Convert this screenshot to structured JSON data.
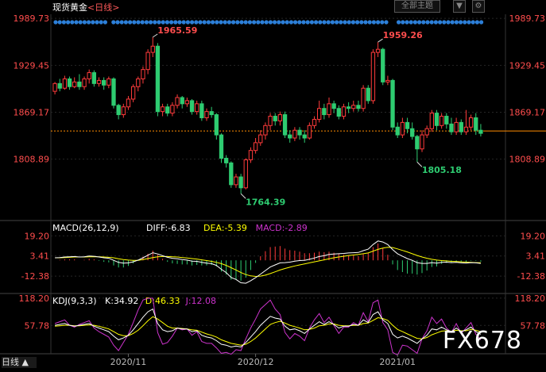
{
  "header": {
    "instrument": "现货黄金",
    "period": "<日线>",
    "sector_button": "全部主题",
    "dropdown_glyph": "▼",
    "settings_glyph": "⚙"
  },
  "watermark": "FX678",
  "period_tab": "日线 ▲",
  "colors": {
    "up": "#ff3b3b",
    "down": "#2ecc71",
    "macd": "#ffffff",
    "dea": "#ffff00",
    "k": "#ffffff",
    "d": "#ffff00",
    "j": "#cc33cc",
    "axis_text": "#ff4d4d",
    "grid": "#262626",
    "ref_line": "#ff8c00"
  },
  "chart_data": [
    {
      "type": "candlestick",
      "title": "现货黄金",
      "ylim": [
        1730,
        1995
      ],
      "y_ticks": [
        1989.73,
        1929.45,
        1869.17,
        1808.89
      ],
      "x_ticks": [
        "2020/11",
        "2020/12",
        "2021/01"
      ],
      "current_price_line": 1845.0,
      "annotations": [
        {
          "label": "1965.59",
          "index": 20
        },
        {
          "label": "1764.39",
          "index": 38
        },
        {
          "label": "1959.26",
          "index": 66
        },
        {
          "label": "1805.18",
          "index": 74
        }
      ],
      "candles": [
        [
          1896,
          1906,
          1892,
          1908
        ],
        [
          1906,
          1900,
          1896,
          1912
        ],
        [
          1900,
          1912,
          1898,
          1916
        ],
        [
          1912,
          1902,
          1898,
          1915
        ],
        [
          1902,
          1908,
          1900,
          1914
        ],
        [
          1908,
          1902,
          1898,
          1918
        ],
        [
          1902,
          1912,
          1898,
          1915
        ],
        [
          1912,
          1920,
          1906,
          1924
        ],
        [
          1920,
          1906,
          1902,
          1923
        ],
        [
          1906,
          1910,
          1902,
          1914
        ],
        [
          1910,
          1904,
          1898,
          1914
        ],
        [
          1904,
          1912,
          1900,
          1915
        ],
        [
          1912,
          1878,
          1874,
          1914
        ],
        [
          1878,
          1866,
          1860,
          1880
        ],
        [
          1866,
          1876,
          1862,
          1880
        ],
        [
          1876,
          1886,
          1872,
          1890
        ],
        [
          1886,
          1902,
          1882,
          1905
        ],
        [
          1902,
          1912,
          1896,
          1915
        ],
        [
          1912,
          1924,
          1906,
          1928
        ],
        [
          1924,
          1946,
          1918,
          1950
        ],
        [
          1946,
          1954,
          1940,
          1965.59
        ],
        [
          1954,
          1870,
          1864,
          1958
        ],
        [
          1870,
          1876,
          1864,
          1880
        ],
        [
          1876,
          1868,
          1864,
          1880
        ],
        [
          1868,
          1878,
          1864,
          1882
        ],
        [
          1878,
          1888,
          1874,
          1892
        ],
        [
          1888,
          1880,
          1874,
          1890
        ],
        [
          1880,
          1884,
          1876,
          1888
        ],
        [
          1884,
          1870,
          1866,
          1886
        ],
        [
          1870,
          1880,
          1866,
          1884
        ],
        [
          1880,
          1862,
          1858,
          1884
        ],
        [
          1862,
          1870,
          1858,
          1874
        ],
        [
          1870,
          1866,
          1862,
          1876
        ],
        [
          1866,
          1840,
          1834,
          1868
        ],
        [
          1840,
          1810,
          1804,
          1842
        ],
        [
          1810,
          1804,
          1798,
          1814
        ],
        [
          1804,
          1776,
          1772,
          1806
        ],
        [
          1776,
          1786,
          1772,
          1790
        ],
        [
          1786,
          1772,
          1764.39,
          1790
        ],
        [
          1772,
          1808,
          1770,
          1810
        ],
        [
          1808,
          1820,
          1804,
          1824
        ],
        [
          1820,
          1830,
          1816,
          1836
        ],
        [
          1830,
          1840,
          1826,
          1846
        ],
        [
          1840,
          1852,
          1834,
          1856
        ],
        [
          1852,
          1864,
          1846,
          1868
        ],
        [
          1864,
          1858,
          1852,
          1868
        ],
        [
          1858,
          1866,
          1852,
          1870
        ],
        [
          1866,
          1840,
          1836,
          1870
        ],
        [
          1840,
          1836,
          1830,
          1846
        ],
        [
          1836,
          1846,
          1832,
          1850
        ],
        [
          1846,
          1840,
          1834,
          1850
        ],
        [
          1840,
          1836,
          1830,
          1846
        ],
        [
          1836,
          1852,
          1834,
          1856
        ],
        [
          1852,
          1860,
          1848,
          1864
        ],
        [
          1860,
          1874,
          1856,
          1884
        ],
        [
          1874,
          1866,
          1860,
          1880
        ],
        [
          1866,
          1880,
          1862,
          1888
        ],
        [
          1880,
          1874,
          1868,
          1884
        ],
        [
          1874,
          1864,
          1860,
          1878
        ],
        [
          1864,
          1876,
          1860,
          1880
        ],
        [
          1876,
          1874,
          1868,
          1882
        ],
        [
          1874,
          1878,
          1870,
          1884
        ],
        [
          1878,
          1874,
          1870,
          1884
        ],
        [
          1874,
          1900,
          1870,
          1904
        ],
        [
          1900,
          1884,
          1880,
          1904
        ],
        [
          1884,
          1946,
          1880,
          1950
        ],
        [
          1946,
          1950,
          1940,
          1959.26
        ],
        [
          1950,
          1908,
          1904,
          1952
        ],
        [
          1908,
          1910,
          1904,
          1916
        ],
        [
          1910,
          1850,
          1846,
          1912
        ],
        [
          1850,
          1840,
          1836,
          1856
        ],
        [
          1840,
          1856,
          1836,
          1862
        ],
        [
          1856,
          1848,
          1842,
          1862
        ],
        [
          1848,
          1838,
          1834,
          1856
        ],
        [
          1838,
          1822,
          1805.18,
          1840
        ],
        [
          1822,
          1840,
          1818,
          1846
        ],
        [
          1840,
          1848,
          1836,
          1852
        ],
        [
          1848,
          1868,
          1844,
          1872
        ],
        [
          1868,
          1852,
          1846,
          1872
        ],
        [
          1852,
          1864,
          1848,
          1868
        ],
        [
          1864,
          1854,
          1848,
          1868
        ],
        [
          1854,
          1844,
          1840,
          1862
        ],
        [
          1844,
          1856,
          1840,
          1862
        ],
        [
          1856,
          1844,
          1840,
          1860
        ],
        [
          1844,
          1850,
          1840,
          1872
        ],
        [
          1850,
          1862,
          1846,
          1866
        ],
        [
          1862,
          1846,
          1840,
          1868
        ],
        [
          1846,
          1842,
          1838,
          1854
        ]
      ]
    },
    {
      "type": "macd",
      "title": "MACD(26,12,9)",
      "legend": [
        {
          "label": "DIFF:-6.83",
          "color": "#ffffff"
        },
        {
          "label": "DEA:-5.39",
          "color": "#ffff00"
        },
        {
          "label": "MACD:-2.89",
          "color": "#cc33cc"
        }
      ],
      "ylim": [
        -26,
        30
      ],
      "y_ticks": [
        19.2,
        3.41,
        -12.38
      ],
      "diff": [
        2,
        2.2,
        2.6,
        2.8,
        3,
        2.6,
        2.8,
        3.4,
        3.2,
        2.6,
        2,
        1.6,
        0,
        -1.6,
        -2.2,
        -2,
        -1.2,
        0.2,
        2,
        4,
        6,
        5,
        3.6,
        2.4,
        1.6,
        1.2,
        0.6,
        0.2,
        -0.6,
        -0.8,
        -1.6,
        -2.2,
        -2.6,
        -4,
        -7,
        -9.6,
        -13.4,
        -15,
        -17.6,
        -18,
        -16,
        -13.6,
        -10.8,
        -8,
        -5.2,
        -3.6,
        -2,
        -1.8,
        -1.4,
        -0.6,
        -0.2,
        0,
        0.8,
        1.8,
        3,
        3.6,
        4.6,
        5,
        5.2,
        5.4,
        5.8,
        6,
        6.2,
        7.6,
        8.8,
        12.4,
        15.2,
        14.4,
        12.4,
        8.4,
        5.2,
        3.2,
        1.4,
        0,
        -1.8,
        -2.4,
        -2.4,
        -1.8,
        -2.2,
        -1.6,
        -1.4,
        -1.8,
        -1.6,
        -2,
        -2.2,
        -1.8,
        -2,
        -2.4
      ],
      "dea": [
        2,
        2,
        2.2,
        2.4,
        2.6,
        2.6,
        2.6,
        2.8,
        2.8,
        2.8,
        2.6,
        2.4,
        2,
        1.2,
        0.6,
        0.2,
        0,
        0,
        0.6,
        1.4,
        2.2,
        2.8,
        3,
        3,
        2.8,
        2.6,
        2.2,
        1.8,
        1.4,
        1,
        0.4,
        -0.2,
        -0.8,
        -1.6,
        -2.6,
        -4,
        -5.8,
        -7.6,
        -9.6,
        -11.2,
        -12.2,
        -12.6,
        -12.4,
        -11.6,
        -10.4,
        -9,
        -7.6,
        -6.4,
        -5.4,
        -4.4,
        -3.6,
        -2.8,
        -2,
        -1.2,
        -0.4,
        0.4,
        1.2,
        2,
        2.6,
        3.2,
        3.8,
        4.2,
        4.6,
        5.2,
        5.8,
        7.2,
        8.6,
        9.6,
        10.2,
        10,
        9,
        7.8,
        6.6,
        5.2,
        3.8,
        2.6,
        1.6,
        0.8,
        0.2,
        -0.2,
        -0.4,
        -0.8,
        -1,
        -1.2,
        -1.4,
        -1.6,
        -1.8,
        -1.9
      ],
      "hist": [
        0,
        0.4,
        0.8,
        0.8,
        0.8,
        0,
        0.4,
        1.2,
        0.8,
        -0.4,
        -1.2,
        -1.6,
        -4,
        -5.6,
        -5.6,
        -4.4,
        -2.4,
        0.4,
        2.8,
        5.2,
        7.6,
        4.4,
        1.2,
        -1.2,
        -2.4,
        -2.8,
        -3.2,
        -3.2,
        -4,
        -3.6,
        -4,
        -4,
        -3.6,
        -4.8,
        -8.8,
        -11.2,
        -15.2,
        -14.8,
        -16,
        -13.6,
        -7.6,
        -2,
        3.2,
        7.2,
        10.4,
        10.8,
        11.2,
        9.2,
        8,
        7.6,
        6.8,
        5.6,
        5.6,
        6,
        6.8,
        6.4,
        6.8,
        6,
        5.2,
        4.4,
        4,
        3.6,
        3.2,
        4.8,
        6,
        10.4,
        13.2,
        9.6,
        4.4,
        -3.2,
        -7.6,
        -9.2,
        -10.4,
        -10.4,
        -11.2,
        -10,
        -8,
        -5.2,
        -4.8,
        -2.8,
        -2,
        -2,
        -1.2,
        -1.6,
        -1.6,
        -0.4,
        -0.4,
        -1
      ]
    },
    {
      "type": "kdj",
      "title": "KDJ(9,3,3)",
      "legend": [
        {
          "label": "K:34.92",
          "color": "#ffffff"
        },
        {
          "label": "D:46.33",
          "color": "#ffff00"
        },
        {
          "label": "J:12.08",
          "color": "#cc33cc"
        }
      ],
      "ylim": [
        -5,
        125
      ],
      "y_ticks": [
        118.2,
        57.78
      ],
      "k": [
        58,
        60,
        62,
        58,
        56,
        58,
        60,
        62,
        56,
        52,
        48,
        44,
        34,
        26,
        30,
        36,
        48,
        62,
        76,
        88,
        94,
        62,
        48,
        44,
        46,
        52,
        50,
        50,
        44,
        46,
        36,
        32,
        30,
        24,
        16,
        14,
        10,
        12,
        10,
        20,
        32,
        44,
        58,
        68,
        78,
        74,
        72,
        56,
        48,
        50,
        46,
        40,
        50,
        58,
        66,
        60,
        66,
        60,
        52,
        56,
        56,
        60,
        58,
        70,
        64,
        82,
        88,
        70,
        62,
        38,
        30,
        34,
        30,
        24,
        18,
        28,
        36,
        50,
        48,
        54,
        48,
        44,
        52,
        44,
        48,
        54,
        44,
        38
      ],
      "d": [
        56,
        57,
        58,
        58,
        57,
        57,
        58,
        59,
        58,
        56,
        53,
        50,
        44,
        38,
        35,
        35,
        40,
        47,
        57,
        68,
        77,
        72,
        64,
        56,
        52,
        52,
        51,
        50,
        48,
        47,
        43,
        39,
        36,
        32,
        26,
        22,
        18,
        16,
        14,
        16,
        22,
        30,
        40,
        50,
        60,
        64,
        67,
        63,
        58,
        55,
        52,
        48,
        49,
        52,
        57,
        58,
        61,
        61,
        58,
        57,
        57,
        58,
        58,
        62,
        63,
        69,
        75,
        73,
        69,
        58,
        49,
        44,
        39,
        34,
        29,
        28,
        31,
        37,
        41,
        45,
        46,
        45,
        47,
        46,
        46,
        49,
        47,
        44
      ],
      "j": [
        62,
        66,
        70,
        58,
        54,
        60,
        64,
        68,
        52,
        44,
        38,
        32,
        14,
        2,
        20,
        38,
        64,
        92,
        114,
        118,
        118,
        42,
        16,
        20,
        34,
        52,
        48,
        50,
        36,
        44,
        22,
        18,
        18,
        8,
        -4,
        -2,
        -6,
        4,
        2,
        28,
        52,
        72,
        94,
        104,
        114,
        94,
        82,
        42,
        28,
        40,
        34,
        24,
        52,
        70,
        84,
        64,
        76,
        58,
        40,
        54,
        54,
        64,
        58,
        86,
        66,
        108,
        114,
        64,
        48,
        -2,
        -8,
        14,
        12,
        4,
        -4,
        28,
        46,
        76,
        62,
        72,
        52,
        42,
        62,
        40,
        52,
        64,
        38,
        26
      ]
    }
  ]
}
